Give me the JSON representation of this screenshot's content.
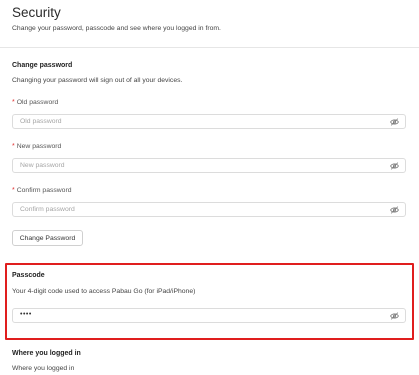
{
  "header": {
    "title": "Security",
    "subtitle": "Change your password, passcode and see where you logged in from."
  },
  "change_password": {
    "title": "Change password",
    "description": "Changing your password will sign out of all your devices.",
    "fields": [
      {
        "label": "Old password",
        "placeholder": "Old password",
        "required_mark": "*"
      },
      {
        "label": "New password",
        "placeholder": "New password",
        "required_mark": "*"
      },
      {
        "label": "Confirm password",
        "placeholder": "Confirm password",
        "required_mark": "*"
      }
    ],
    "button_label": "Change Password"
  },
  "passcode": {
    "title": "Passcode",
    "description": "Your 4-digit code used to access Pabau Go (for iPad/iPhone)",
    "value": "••••",
    "highlight_color": "#e01e1e"
  },
  "logins": {
    "title": "Where you logged in",
    "description": "Where you logged in"
  },
  "icons": {
    "visibility_toggle": "eye-slash-icon"
  }
}
